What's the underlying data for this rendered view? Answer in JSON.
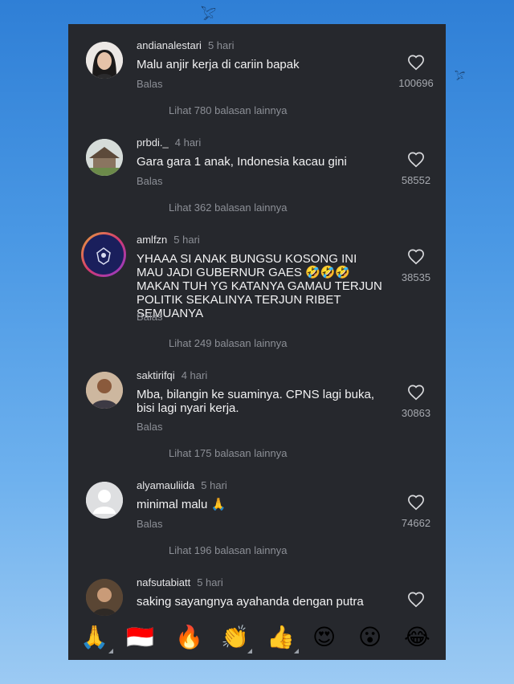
{
  "comments": [
    {
      "username": "andianalestari",
      "time": "5 hari",
      "text": "Malu anjir kerja di cariin bapak",
      "reply": "Balas",
      "more": "Lihat 780 balasan lainnya",
      "likes": "100696"
    },
    {
      "username": "prbdi._",
      "time": "4 hari",
      "text": "Gara gara 1 anak, Indonesia kacau gini",
      "reply": "Balas",
      "more": "Lihat 362 balasan lainnya",
      "likes": "58552"
    },
    {
      "username": "amlfzn",
      "time": "5 hari",
      "text": "YHAAA SI ANAK BUNGSU KOSONG INI MAU JADI GUBERNUR GAES 🤣🤣🤣MAKAN TUH YG KATANYA GAMAU TERJUN POLITIK SEKALINYA TERJUN RIBET SEMUANYA",
      "reply": "Balas",
      "more": "Lihat 249 balasan lainnya",
      "likes": "38535"
    },
    {
      "username": "saktirifqi",
      "time": "4 hari",
      "text": "Mba, bilangin ke suaminya. CPNS lagi buka, bisi lagi nyari kerja.",
      "reply": "Balas",
      "more": "Lihat 175 balasan lainnya",
      "likes": "30863"
    },
    {
      "username": "alyamauliida",
      "time": "5 hari",
      "text": "minimal malu 🙏",
      "reply": "Balas",
      "more": "Lihat 196 balasan lainnya",
      "likes": "74662"
    },
    {
      "username": "nafsutabiatt",
      "time": "5 hari",
      "text": "saking sayangnya ayahanda dengan putra",
      "reply": "",
      "more": "",
      "likes": ""
    }
  ],
  "emojis": [
    "🙏",
    "🇮🇩",
    "🔥",
    "👏",
    "👍",
    "😍",
    "😮",
    "😂"
  ]
}
